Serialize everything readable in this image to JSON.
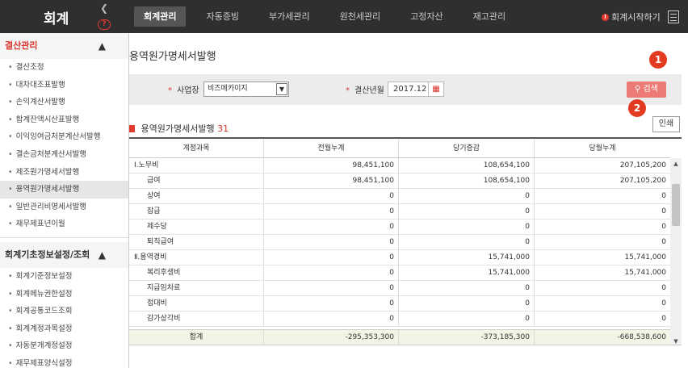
{
  "app": {
    "title": "회계",
    "collapse_icon": "chevron-left-icon",
    "help_icon": "question-icon"
  },
  "topnav": {
    "tabs": [
      "회계관리",
      "자동증빙",
      "부가세관리",
      "원천세관리",
      "고정자산",
      "재고관리"
    ],
    "active": 0,
    "start_label": "회계시작하기"
  },
  "sidebar": {
    "sec1": {
      "title": "결산관리",
      "items": [
        "결산조정",
        "대차대조표발행",
        "손익계산서발행",
        "합계잔액시산표발행",
        "이익잉여금처분계산서발행",
        "결손금처분계산서발행",
        "제조원가명세서발행",
        "용역원가명세서발행",
        "일반관리비명세서발행",
        "재무제표년이월"
      ],
      "active": 7
    },
    "sec2": {
      "title": "회계기초정보설정/조회",
      "items": [
        "회계기준정보설정",
        "회계메뉴권한설정",
        "회계공통코드조회",
        "회계계정과목설정",
        "자동분개계정설정",
        "재무제표양식설정"
      ]
    }
  },
  "page": {
    "title": "용역원가명세서발행"
  },
  "filter": {
    "biz_label": "사업장",
    "biz_value": "비즈메카이지",
    "period_label": "결산년월",
    "period_value": "2017.12",
    "search_label": "검색"
  },
  "markers": [
    "1",
    "2"
  ],
  "section": {
    "title": "용역원가명세서발행",
    "count": "31",
    "print_label": "인쇄"
  },
  "table": {
    "headers": [
      "계정과목",
      "전월누계",
      "당기증감",
      "당월누계"
    ],
    "rows": [
      {
        "name": "Ⅰ.노무비",
        "level": 0,
        "prev": "98,451,100",
        "delta": "108,654,100",
        "curr": "207,105,200"
      },
      {
        "name": "급여",
        "level": 1,
        "prev": "98,451,100",
        "delta": "108,654,100",
        "curr": "207,105,200"
      },
      {
        "name": "상여",
        "level": 1,
        "prev": "0",
        "delta": "0",
        "curr": "0"
      },
      {
        "name": "잡급",
        "level": 1,
        "prev": "0",
        "delta": "0",
        "curr": "0"
      },
      {
        "name": "제수당",
        "level": 1,
        "prev": "0",
        "delta": "0",
        "curr": "0"
      },
      {
        "name": "퇴직급여",
        "level": 1,
        "prev": "0",
        "delta": "0",
        "curr": "0"
      },
      {
        "name": "Ⅱ.용역경비",
        "level": 0,
        "prev": "0",
        "delta": "15,741,000",
        "curr": "15,741,000"
      },
      {
        "name": "복리후생비",
        "level": 1,
        "prev": "0",
        "delta": "15,741,000",
        "curr": "15,741,000"
      },
      {
        "name": "지급임차료",
        "level": 1,
        "prev": "0",
        "delta": "0",
        "curr": "0"
      },
      {
        "name": "접대비",
        "level": 1,
        "prev": "0",
        "delta": "0",
        "curr": "0"
      },
      {
        "name": "감가상각비",
        "level": 1,
        "prev": "0",
        "delta": "0",
        "curr": "0"
      }
    ],
    "total": {
      "label": "합계",
      "prev": "-295,353,300",
      "delta": "-373,185,300",
      "curr": "-668,538,600"
    }
  },
  "colors": {
    "accent": "#d9332a",
    "topbar": "#2f2f2f",
    "search": "#ee7a76"
  }
}
